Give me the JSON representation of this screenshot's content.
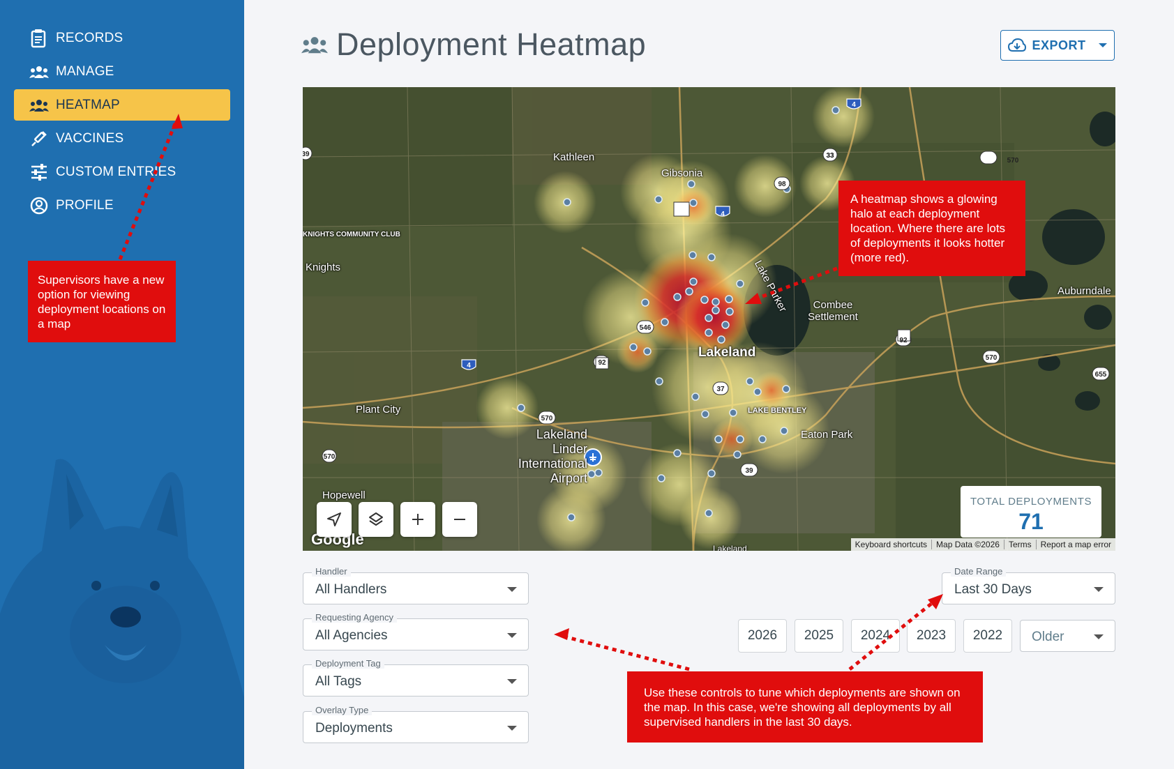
{
  "sidebar": {
    "items": [
      {
        "label": "RECORDS",
        "icon": "clipboard-icon"
      },
      {
        "label": "MANAGE",
        "icon": "group-icon"
      },
      {
        "label": "HEATMAP",
        "icon": "group-icon",
        "active": true
      },
      {
        "label": "VACCINES",
        "icon": "syringe-icon"
      },
      {
        "label": "CUSTOM ENTRIES",
        "icon": "sliders-icon"
      },
      {
        "label": "PROFILE",
        "icon": "user-circle-icon"
      }
    ]
  },
  "header": {
    "title": "Deployment Heatmap",
    "export_label": "EXPORT"
  },
  "map": {
    "places": [
      "Kathleen",
      "Gibsonia",
      "Knights",
      "KNIGHTS COMMUNITY CLUB",
      "Lakeland",
      "Lake Parker",
      "Combee Settlement",
      "Auburndale",
      "Plant City",
      "Lakeland Linder International Airport",
      "LAKE BENTLEY",
      "Eaton Park",
      "Hopewell",
      "Lakeland"
    ],
    "road_shields": [
      "4",
      "33",
      "570",
      "98",
      "4",
      "33",
      "546",
      "92",
      "92",
      "570",
      "4",
      "37",
      "570",
      "39",
      "570",
      "655",
      "39"
    ],
    "google_label": "Google",
    "attribution": [
      "Keyboard shortcuts",
      "Map Data ©2026",
      "Terms",
      "Report a map error"
    ],
    "total_label": "TOTAL DEPLOYMENTS",
    "total_value": "71"
  },
  "filters": {
    "handler": {
      "label": "Handler",
      "value": "All Handlers"
    },
    "agency": {
      "label": "Requesting Agency",
      "value": "All Agencies"
    },
    "tag": {
      "label": "Deployment Tag",
      "value": "All Tags"
    },
    "overlay": {
      "label": "Overlay Type",
      "value": "Deployments"
    },
    "date_range": {
      "label": "Date Range",
      "value": "Last 30 Days"
    },
    "years": [
      "2026",
      "2025",
      "2024",
      "2023",
      "2022"
    ],
    "older": "Older"
  },
  "callouts": {
    "sidebar_note": "Supervisors have a new option for viewing deployment locations on a map",
    "heatmap_note": "A heatmap shows a glowing halo at each deployment location. Where there are lots of deployments it looks hotter (more red).",
    "controls_note": "Use these controls to tune which deployments are shown on the map. In this case, we're showing all deployments by all supervised handlers in the last 30 days."
  },
  "colors": {
    "sidebar": "#1f6fb0",
    "active": "#f6c449",
    "callout": "#e00d0d",
    "accent": "#1f6fb0"
  }
}
